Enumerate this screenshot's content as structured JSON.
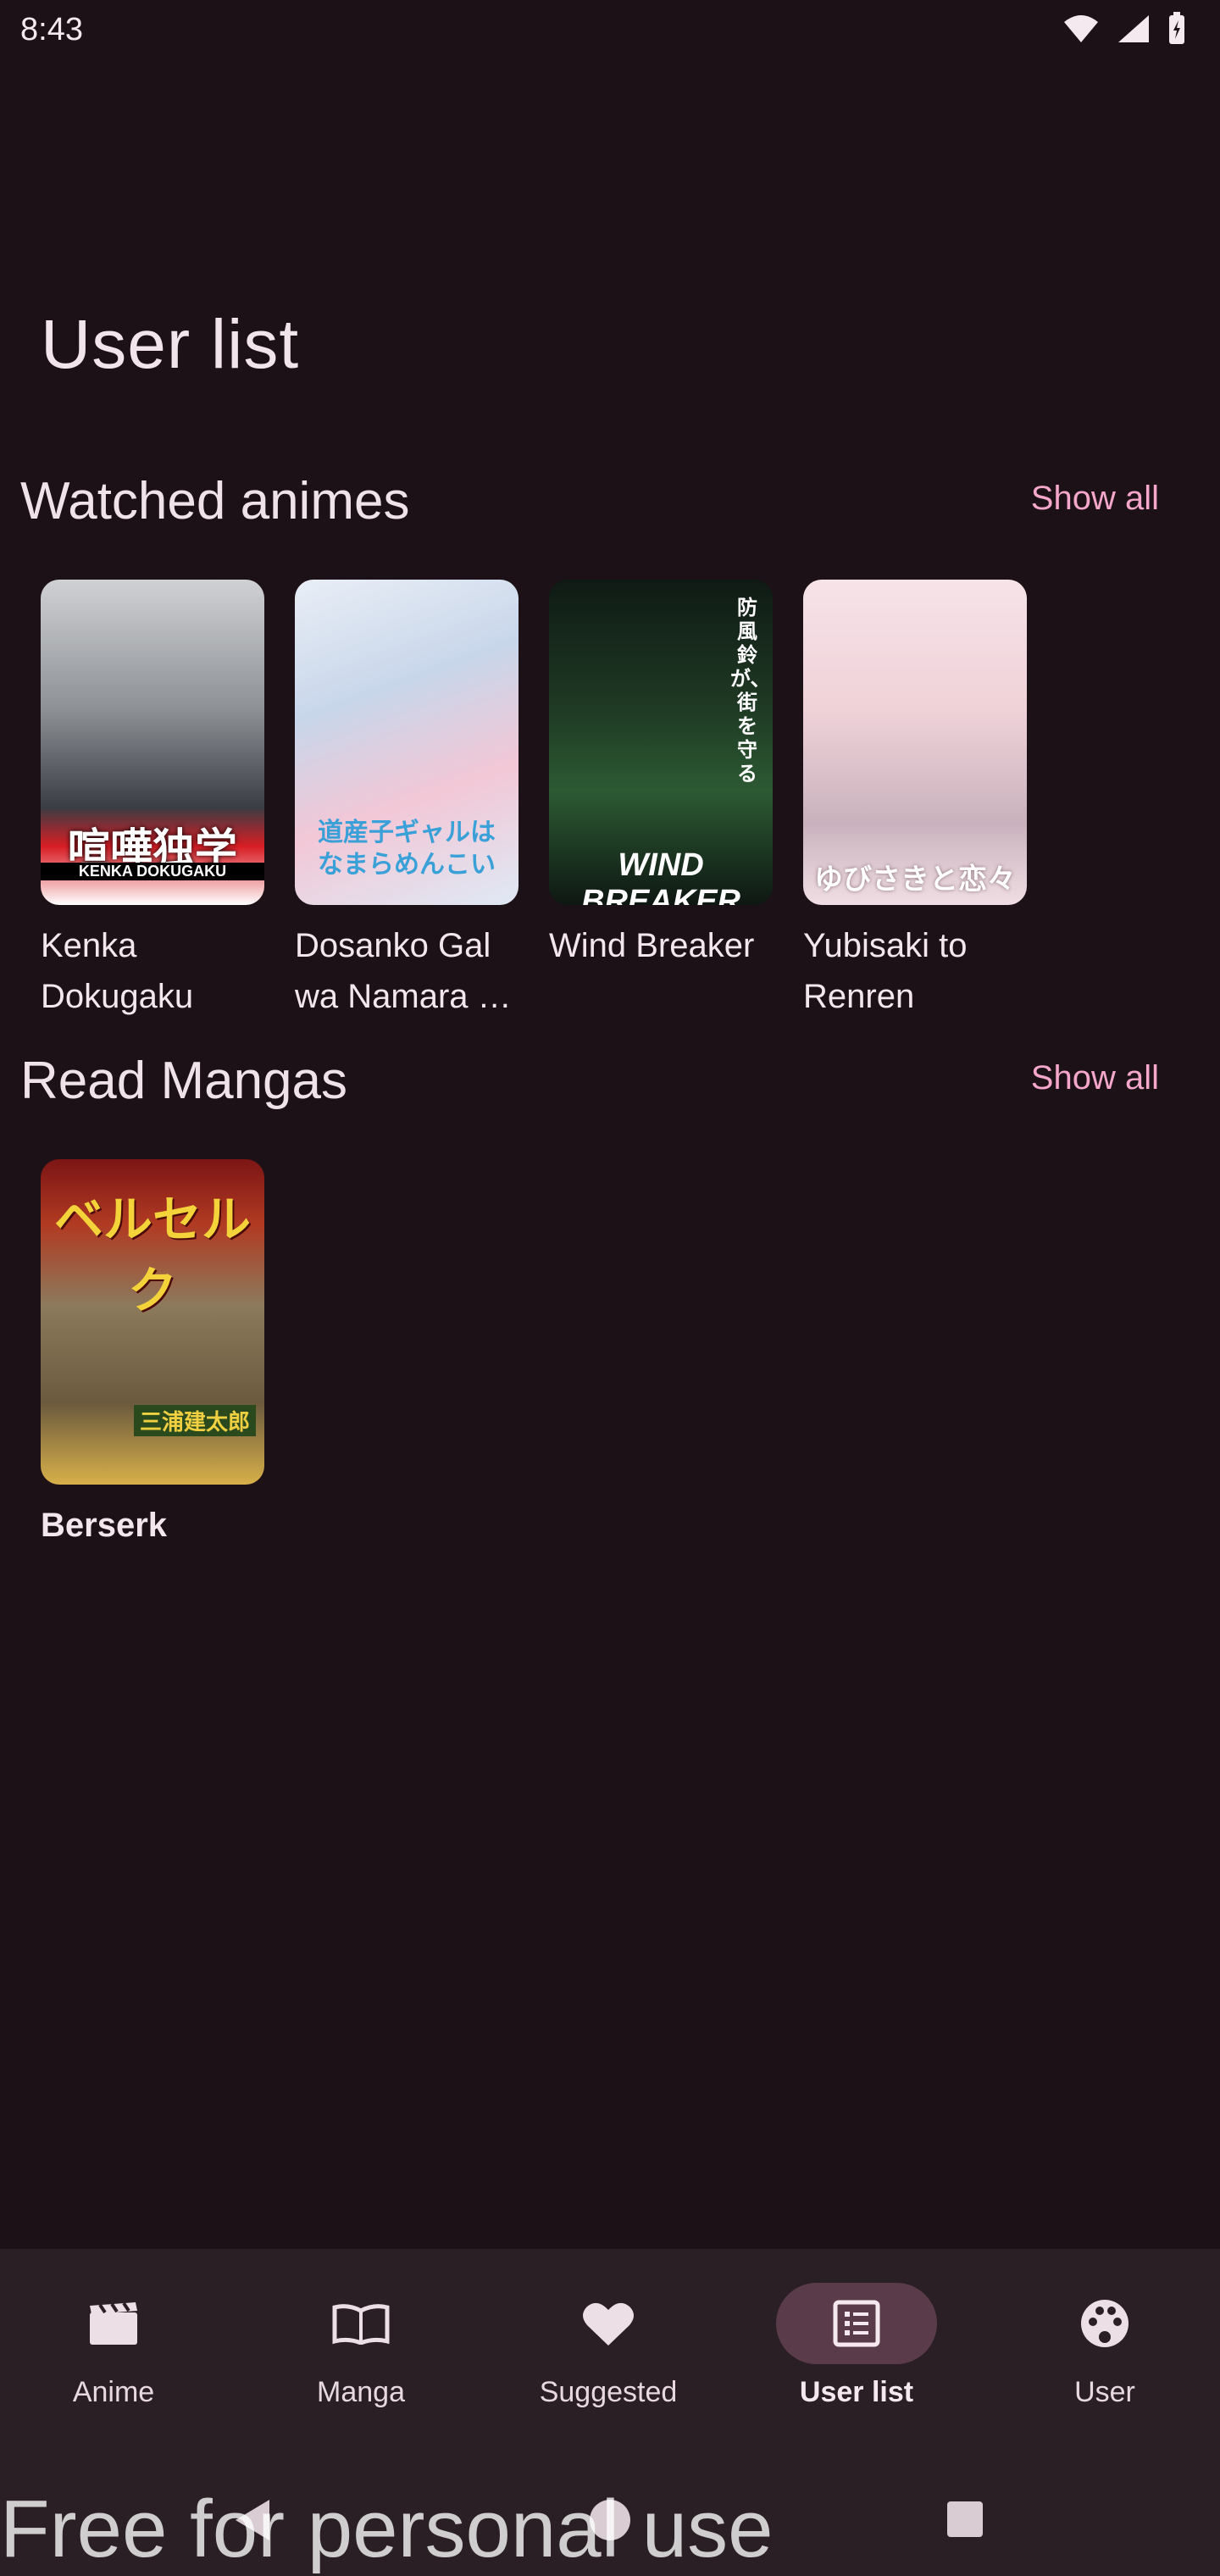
{
  "status_bar": {
    "time": "8:43"
  },
  "page": {
    "title": "User list"
  },
  "sections": {
    "watched": {
      "title": "Watched animes",
      "show_all": "Show all",
      "items": [
        {
          "title": "Kenka Dokugaku",
          "cover_text": "喧嘩独学",
          "cover_sub": "KENKA DOKUGAKU"
        },
        {
          "title": "Dosanko Gal wa Namara …",
          "cover_text": "道産子ギャルはなまらめんこい",
          "cover_sub": ""
        },
        {
          "title": "Wind Breaker",
          "cover_text": "WIND BREAKER",
          "cover_sub": "防風鈴が、街を守る"
        },
        {
          "title": "Yubisaki to Renren",
          "cover_text": "ゆびさきと恋々",
          "cover_sub": ""
        }
      ]
    },
    "read": {
      "title": "Read Mangas",
      "show_all": "Show all",
      "items": [
        {
          "title": "Berserk",
          "cover_text": "ベルセルク",
          "cover_sub": "三浦建太郎"
        }
      ]
    }
  },
  "bottom_nav": {
    "items": [
      {
        "label": "Anime",
        "icon": "clapperboard-icon",
        "active": false
      },
      {
        "label": "Manga",
        "icon": "book-icon",
        "active": false
      },
      {
        "label": "Suggested",
        "icon": "heart-icon",
        "active": false
      },
      {
        "label": "User list",
        "icon": "list-icon",
        "active": true
      },
      {
        "label": "User",
        "icon": "palette-icon",
        "active": false
      }
    ]
  },
  "watermark": "Free for personal use",
  "colors": {
    "background": "#1b1116",
    "accent": "#f4a6cb",
    "nav_bg": "#2a1f25",
    "active_pill": "#5a3b4a"
  }
}
